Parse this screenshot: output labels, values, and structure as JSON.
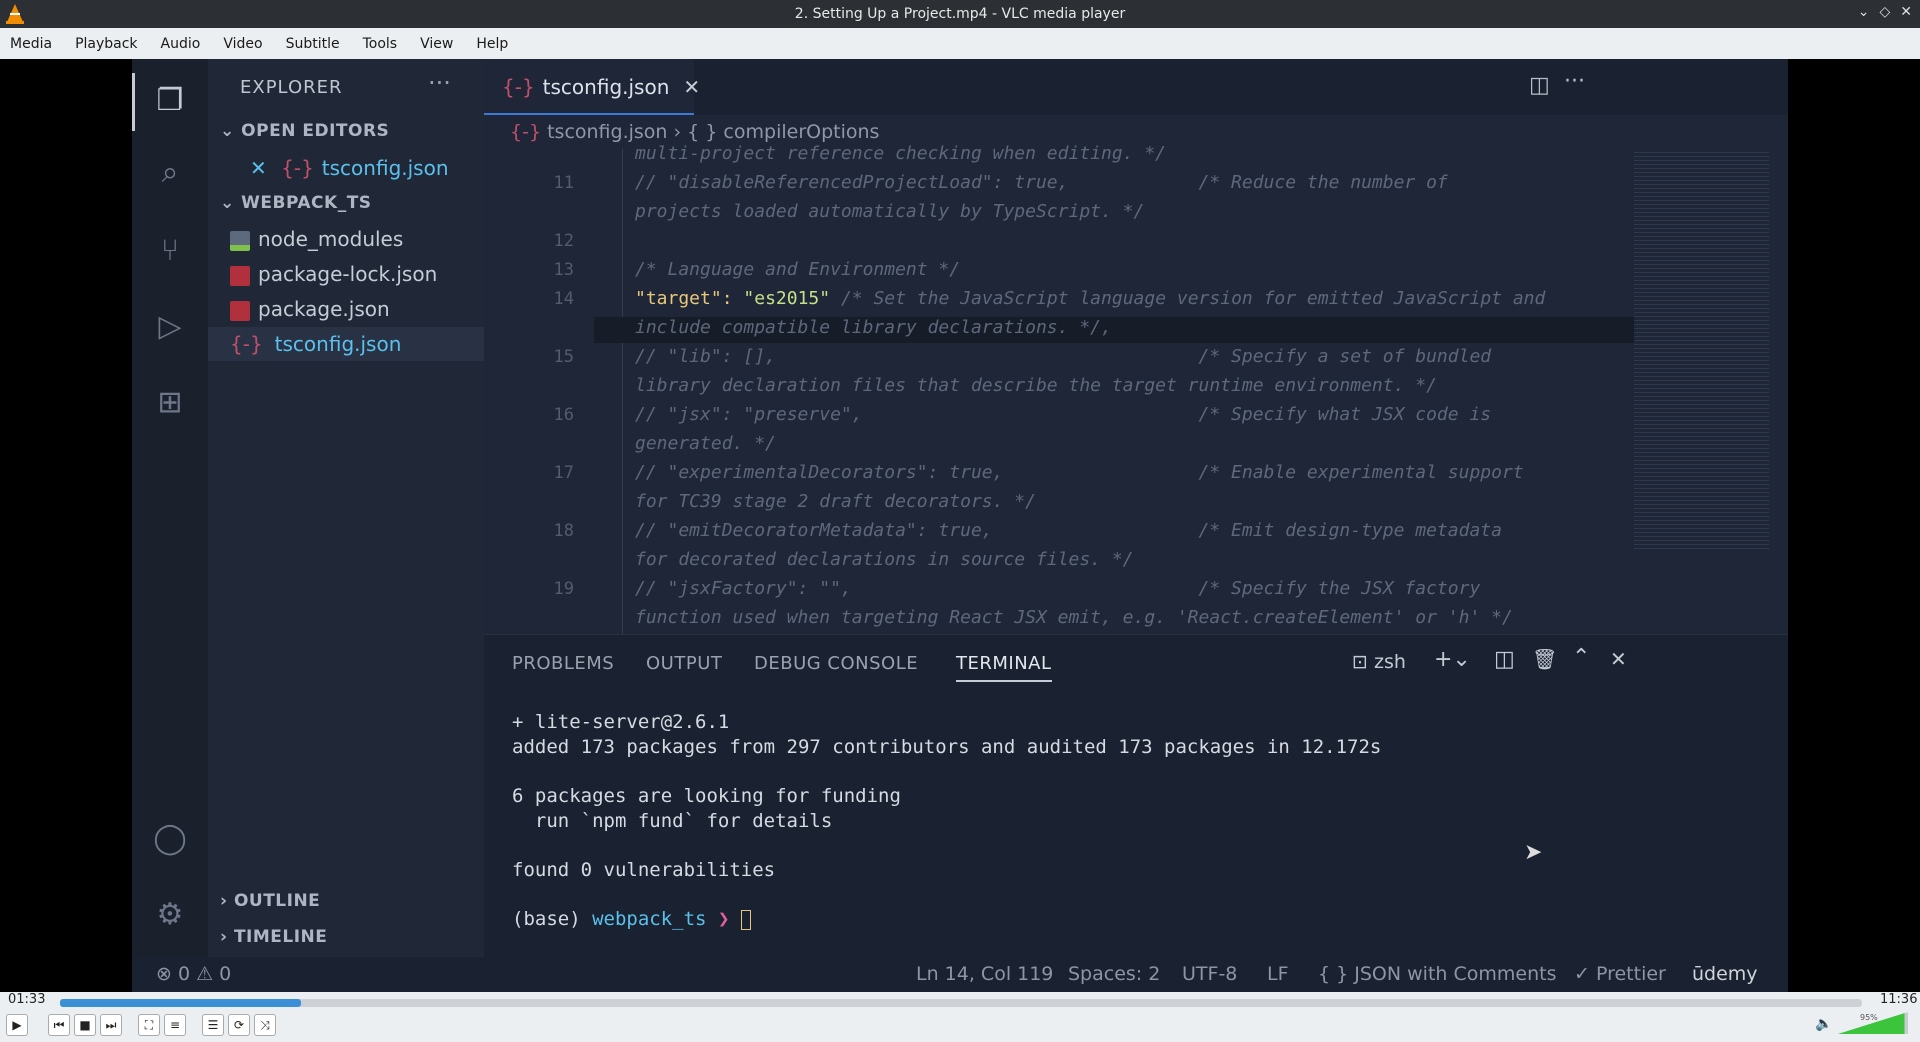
{
  "window": {
    "title": "2. Setting Up a Project.mp4 - VLC media player"
  },
  "menu": [
    "Media",
    "Playback",
    "Audio",
    "Video",
    "Subtitle",
    "Tools",
    "View",
    "Help"
  ],
  "vscode": {
    "sidebar": {
      "header": "EXPLORER",
      "more": "···",
      "open_editors": "OPEN EDITORS",
      "open_file": "tsconfig.json",
      "project": "WEBPACK_TS",
      "files": [
        "node_modules",
        "package-lock.json",
        "package.json",
        "tsconfig.json"
      ],
      "outline": "OUTLINE",
      "timeline": "TIMELINE"
    },
    "tab": {
      "label": "tsconfig.json",
      "close": "✕"
    },
    "breadcrumb": {
      "file": "tsconfig.json",
      "sep": "›",
      "node": "{ } compilerOptions"
    },
    "code": {
      "line_numbers": [
        "11",
        "12",
        "13",
        "14",
        "15",
        "16",
        "17",
        "18",
        "19"
      ],
      "lines": [
        "multi-project reference checking when editing. */",
        "// \"disableReferencedProjectLoad\": true,            /* Reduce the number of",
        "projects loaded automatically by TypeScript. */",
        "/* Language and Environment */",
        "/* Set the JavaScript language version for emitted JavaScript and",
        "include compatible library declarations. */,",
        "// \"lib\": [],                                       /* Specify a set of bundled",
        "library declaration files that describe the target runtime environment. */",
        "// \"jsx\": \"preserve\",                               /* Specify what JSX code is",
        "generated. */",
        "// \"experimentalDecorators\": true,                  /* Enable experimental support",
        "for TC39 stage 2 draft decorators. */",
        "// \"emitDecoratorMetadata\": true,                   /* Emit design-type metadata",
        "for decorated declarations in source files. */",
        "// \"jsxFactory\": \"\",                                /* Specify the JSX factory",
        "function used when targeting React JSX emit, e.g. 'React.createElement' or 'h' */"
      ],
      "target_key": "\"target\":",
      "target_value": "\"es2015\""
    },
    "panel": {
      "tabs": [
        "PROBLEMS",
        "OUTPUT",
        "DEBUG CONSOLE",
        "TERMINAL"
      ],
      "shell": "zsh",
      "terminal": [
        "+ lite-server@2.6.1",
        "added 173 packages from 297 contributors and audited 173 packages in 12.172s",
        "6 packages are looking for funding",
        "  run `npm fund` for details",
        "found 0 vulnerabilities"
      ],
      "prompt_env": "(base)",
      "prompt_dir": "webpack_ts",
      "prompt_arrow": "❯"
    },
    "status": {
      "problems": "⊗ 0 ⚠ 0",
      "position": "Ln 14, Col 119",
      "spaces": "Spaces: 2",
      "encoding": "UTF-8",
      "eol": "LF",
      "language": "{ } JSON with Comments",
      "prettier": "✓ Prettier",
      "watermark": "ūdemy"
    }
  },
  "player": {
    "elapsed": "01:33",
    "total": "11:36",
    "progress_fraction": 0.134,
    "volume": "95%",
    "volume_fraction": 0.95
  }
}
